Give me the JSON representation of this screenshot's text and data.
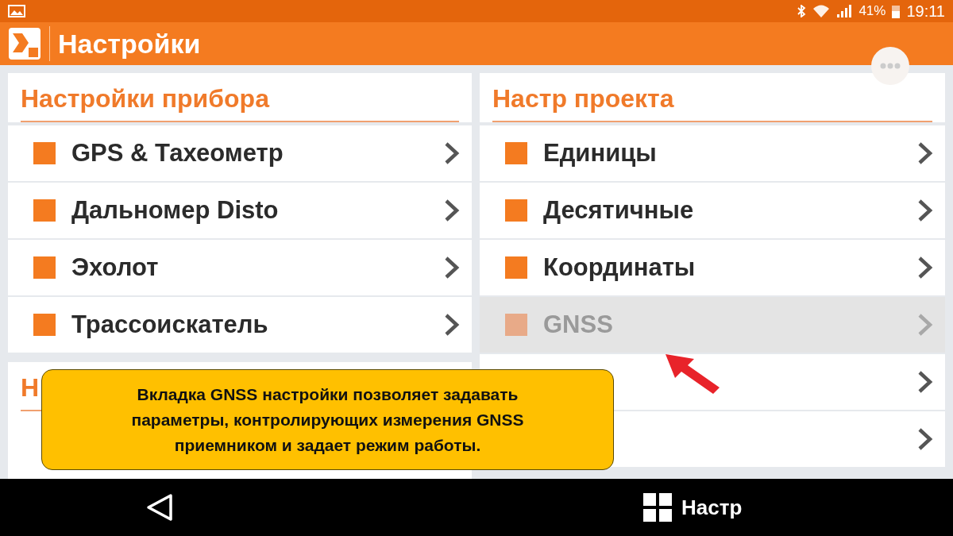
{
  "status_bar": {
    "battery": "41%",
    "time": "19:11"
  },
  "app_bar": {
    "title": "Настройки"
  },
  "left_sections": [
    {
      "title": "Настройки прибора",
      "items": [
        {
          "label": "GPS & Тахеометр",
          "disabled": false
        },
        {
          "label": "Дальномер Disto",
          "disabled": false
        },
        {
          "label": "Эхолот",
          "disabled": false
        },
        {
          "label": "Трассоискатель",
          "disabled": false
        }
      ]
    },
    {
      "title": "Н"
    }
  ],
  "right_section": {
    "title": "Настр проекта",
    "items": [
      {
        "label": "Единицы",
        "disabled": false
      },
      {
        "label": "Десятичные",
        "disabled": false
      },
      {
        "label": "Координаты",
        "disabled": false
      },
      {
        "label": "GNSS",
        "disabled": true
      },
      {
        "disabled": false
      },
      {
        "disabled": false
      }
    ]
  },
  "callout": {
    "text": "Вкладка GNSS настройки позволяет задавать параметры, контролирующих измерения GNSS приемником и задает режим работы."
  },
  "nav_bar": {
    "menu_label": "Настр"
  }
}
